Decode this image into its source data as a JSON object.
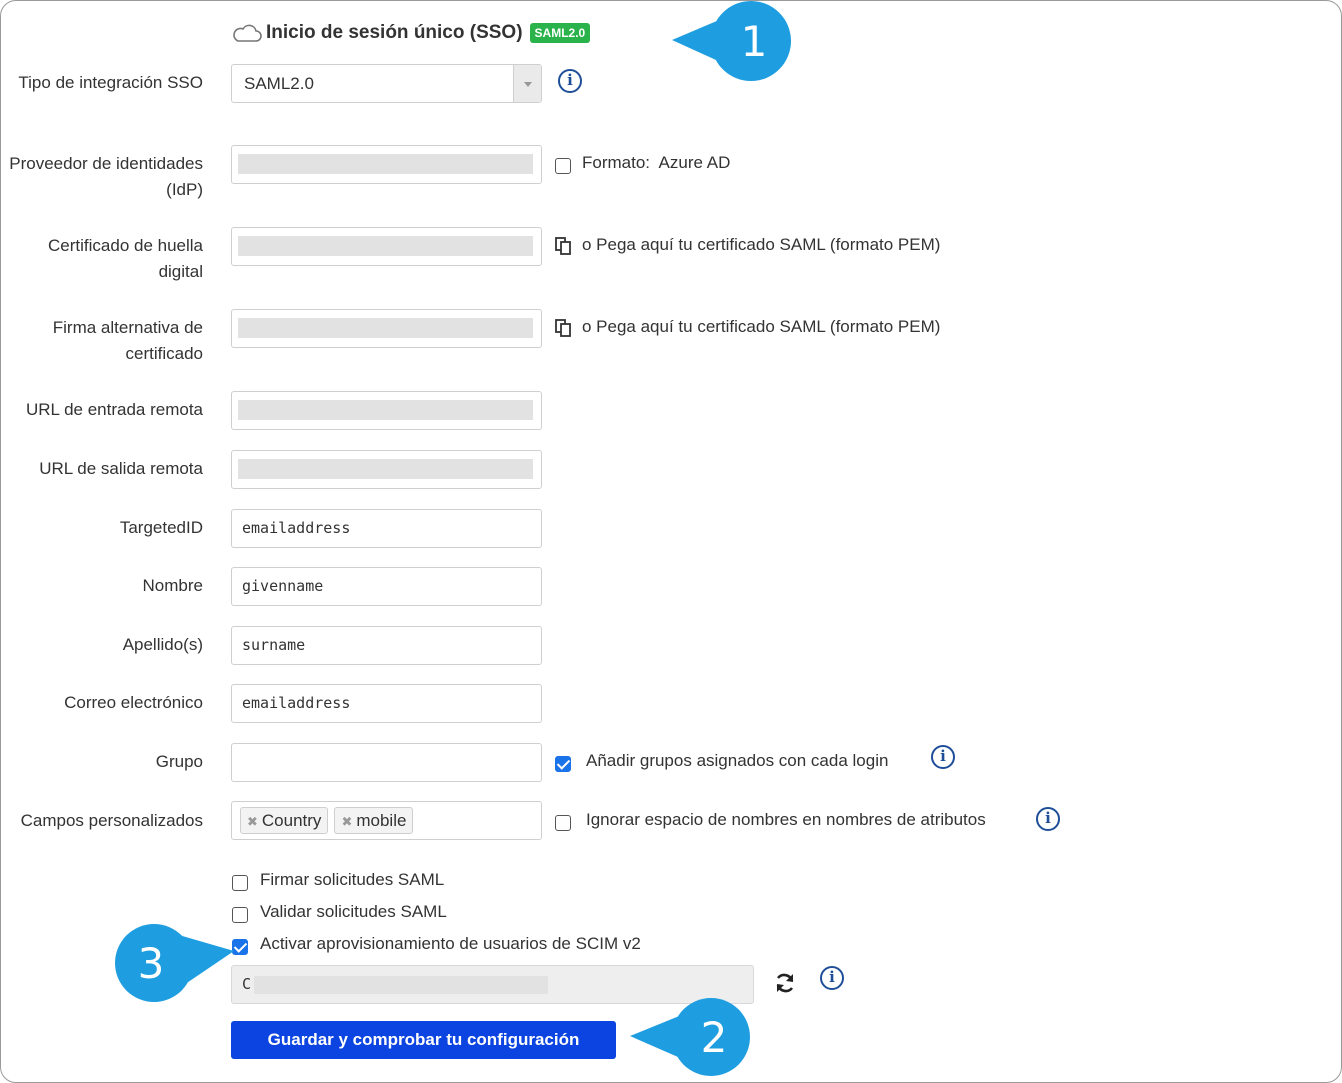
{
  "header": {
    "title": "Inicio de sesión único (SSO)",
    "badge": "SAML2.0"
  },
  "fields": {
    "sso_type": {
      "label": "Tipo de integración SSO",
      "value": "SAML2.0"
    },
    "idp": {
      "label": "Proveedor de identidades (IdP)",
      "format_label": "Formato:",
      "format_value": "Azure AD"
    },
    "cert": {
      "label": "Certificado de huella digital",
      "paste_text": "o Pega aquí tu certificado SAML (formato PEM)"
    },
    "alt_cert": {
      "label": "Firma alternativa de certificado",
      "paste_text": "o Pega aquí tu certificado SAML (formato PEM)"
    },
    "login_url": {
      "label": "URL de entrada remota"
    },
    "logout_url": {
      "label": "URL de salida remota"
    },
    "targeted_id": {
      "label": "TargetedID",
      "value": "emailaddress"
    },
    "first_name": {
      "label": "Nombre",
      "value": "givenname"
    },
    "last_name": {
      "label": "Apellido(s)",
      "value": "surname"
    },
    "email": {
      "label": "Correo electrónico",
      "value": "emailaddress"
    },
    "group": {
      "label": "Grupo",
      "value": "",
      "checkbox_label": "Añadir grupos asignados con cada login",
      "checked": true
    },
    "custom_fields": {
      "label": "Campos personalizados",
      "tags": [
        "Country",
        "mobile"
      ],
      "checkbox_label": "Ignorar espacio de nombres en nombres de atributos",
      "checked": false
    }
  },
  "options": {
    "sign_requests": {
      "label": "Firmar solicitudes SAML",
      "checked": false
    },
    "validate_requests": {
      "label": "Validar solicitudes SAML",
      "checked": false
    },
    "scim": {
      "label": "Activar aprovisionamiento de usuarios de SCIM v2",
      "checked": true,
      "token_prefix": "C"
    }
  },
  "save_button": {
    "label": "Guardar y comprobar tu configuración"
  },
  "callouts": [
    "1",
    "2",
    "3"
  ],
  "icons": {
    "header": "cloud-icon",
    "info": "info-icon",
    "copy": "copy-icon",
    "refresh": "refresh-icon"
  },
  "colors": {
    "badge": "#2bb34b",
    "primary_button": "#0b44e0",
    "info": "#1f4e99",
    "callout": "#1e9ee0",
    "checkbox": "#1a73e8"
  }
}
